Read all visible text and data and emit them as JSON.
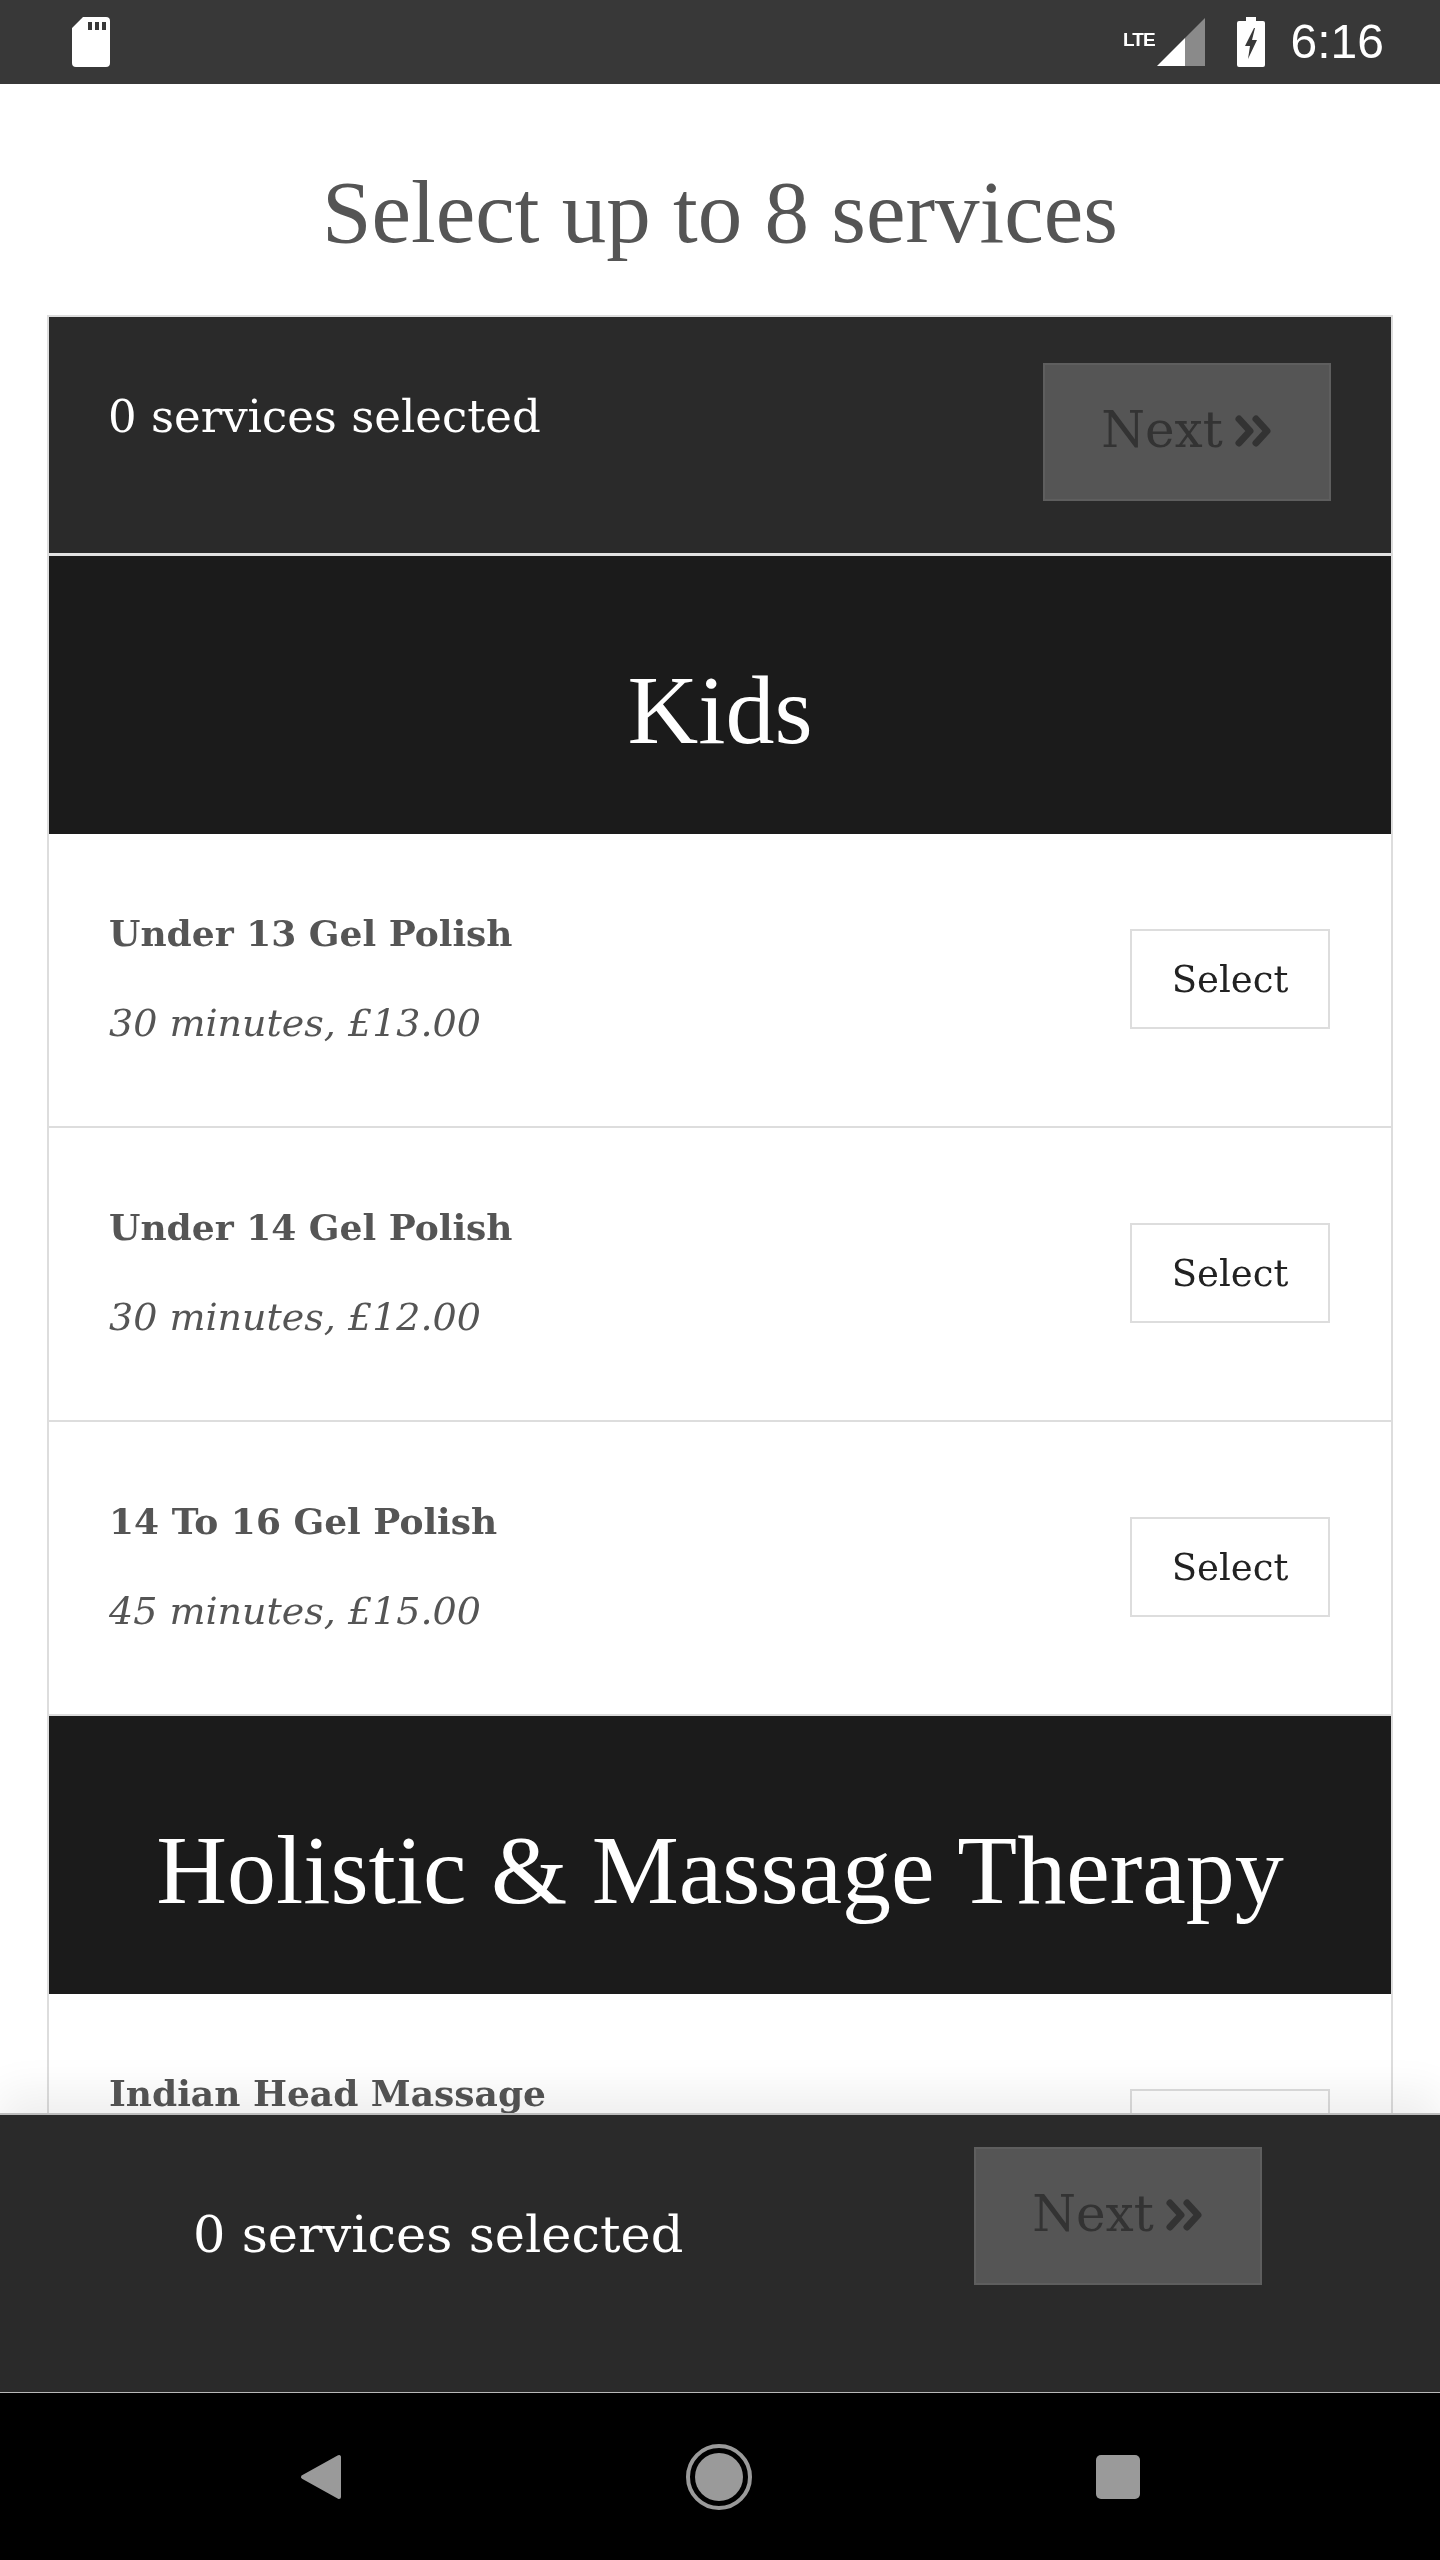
{
  "status_bar": {
    "network_label": "LTE",
    "time": "6:16"
  },
  "title": "Select up to 8 services",
  "selection_bar": {
    "count_label": "0 services selected",
    "next_button": {
      "label": "Next",
      "disabled": true
    }
  },
  "categories": [
    {
      "title": "Kids",
      "services": [
        {
          "name": "Under 13 Gel Polish",
          "details": "30 minutes, £13.00",
          "button": "Select"
        },
        {
          "name": "Under 14 Gel Polish",
          "details": "30 minutes, £12.00",
          "button": "Select"
        },
        {
          "name": "14 To 16 Gel Polish",
          "details": "45 minutes, £15.00",
          "button": "Select"
        }
      ]
    },
    {
      "title": "Holistic & Massage Therapy",
      "services": [
        {
          "name": "Indian Head Massage"
        }
      ]
    }
  ],
  "bottom_bar": {
    "count_label": "0 services selected",
    "next_button": {
      "label": "Next",
      "disabled": true
    }
  }
}
